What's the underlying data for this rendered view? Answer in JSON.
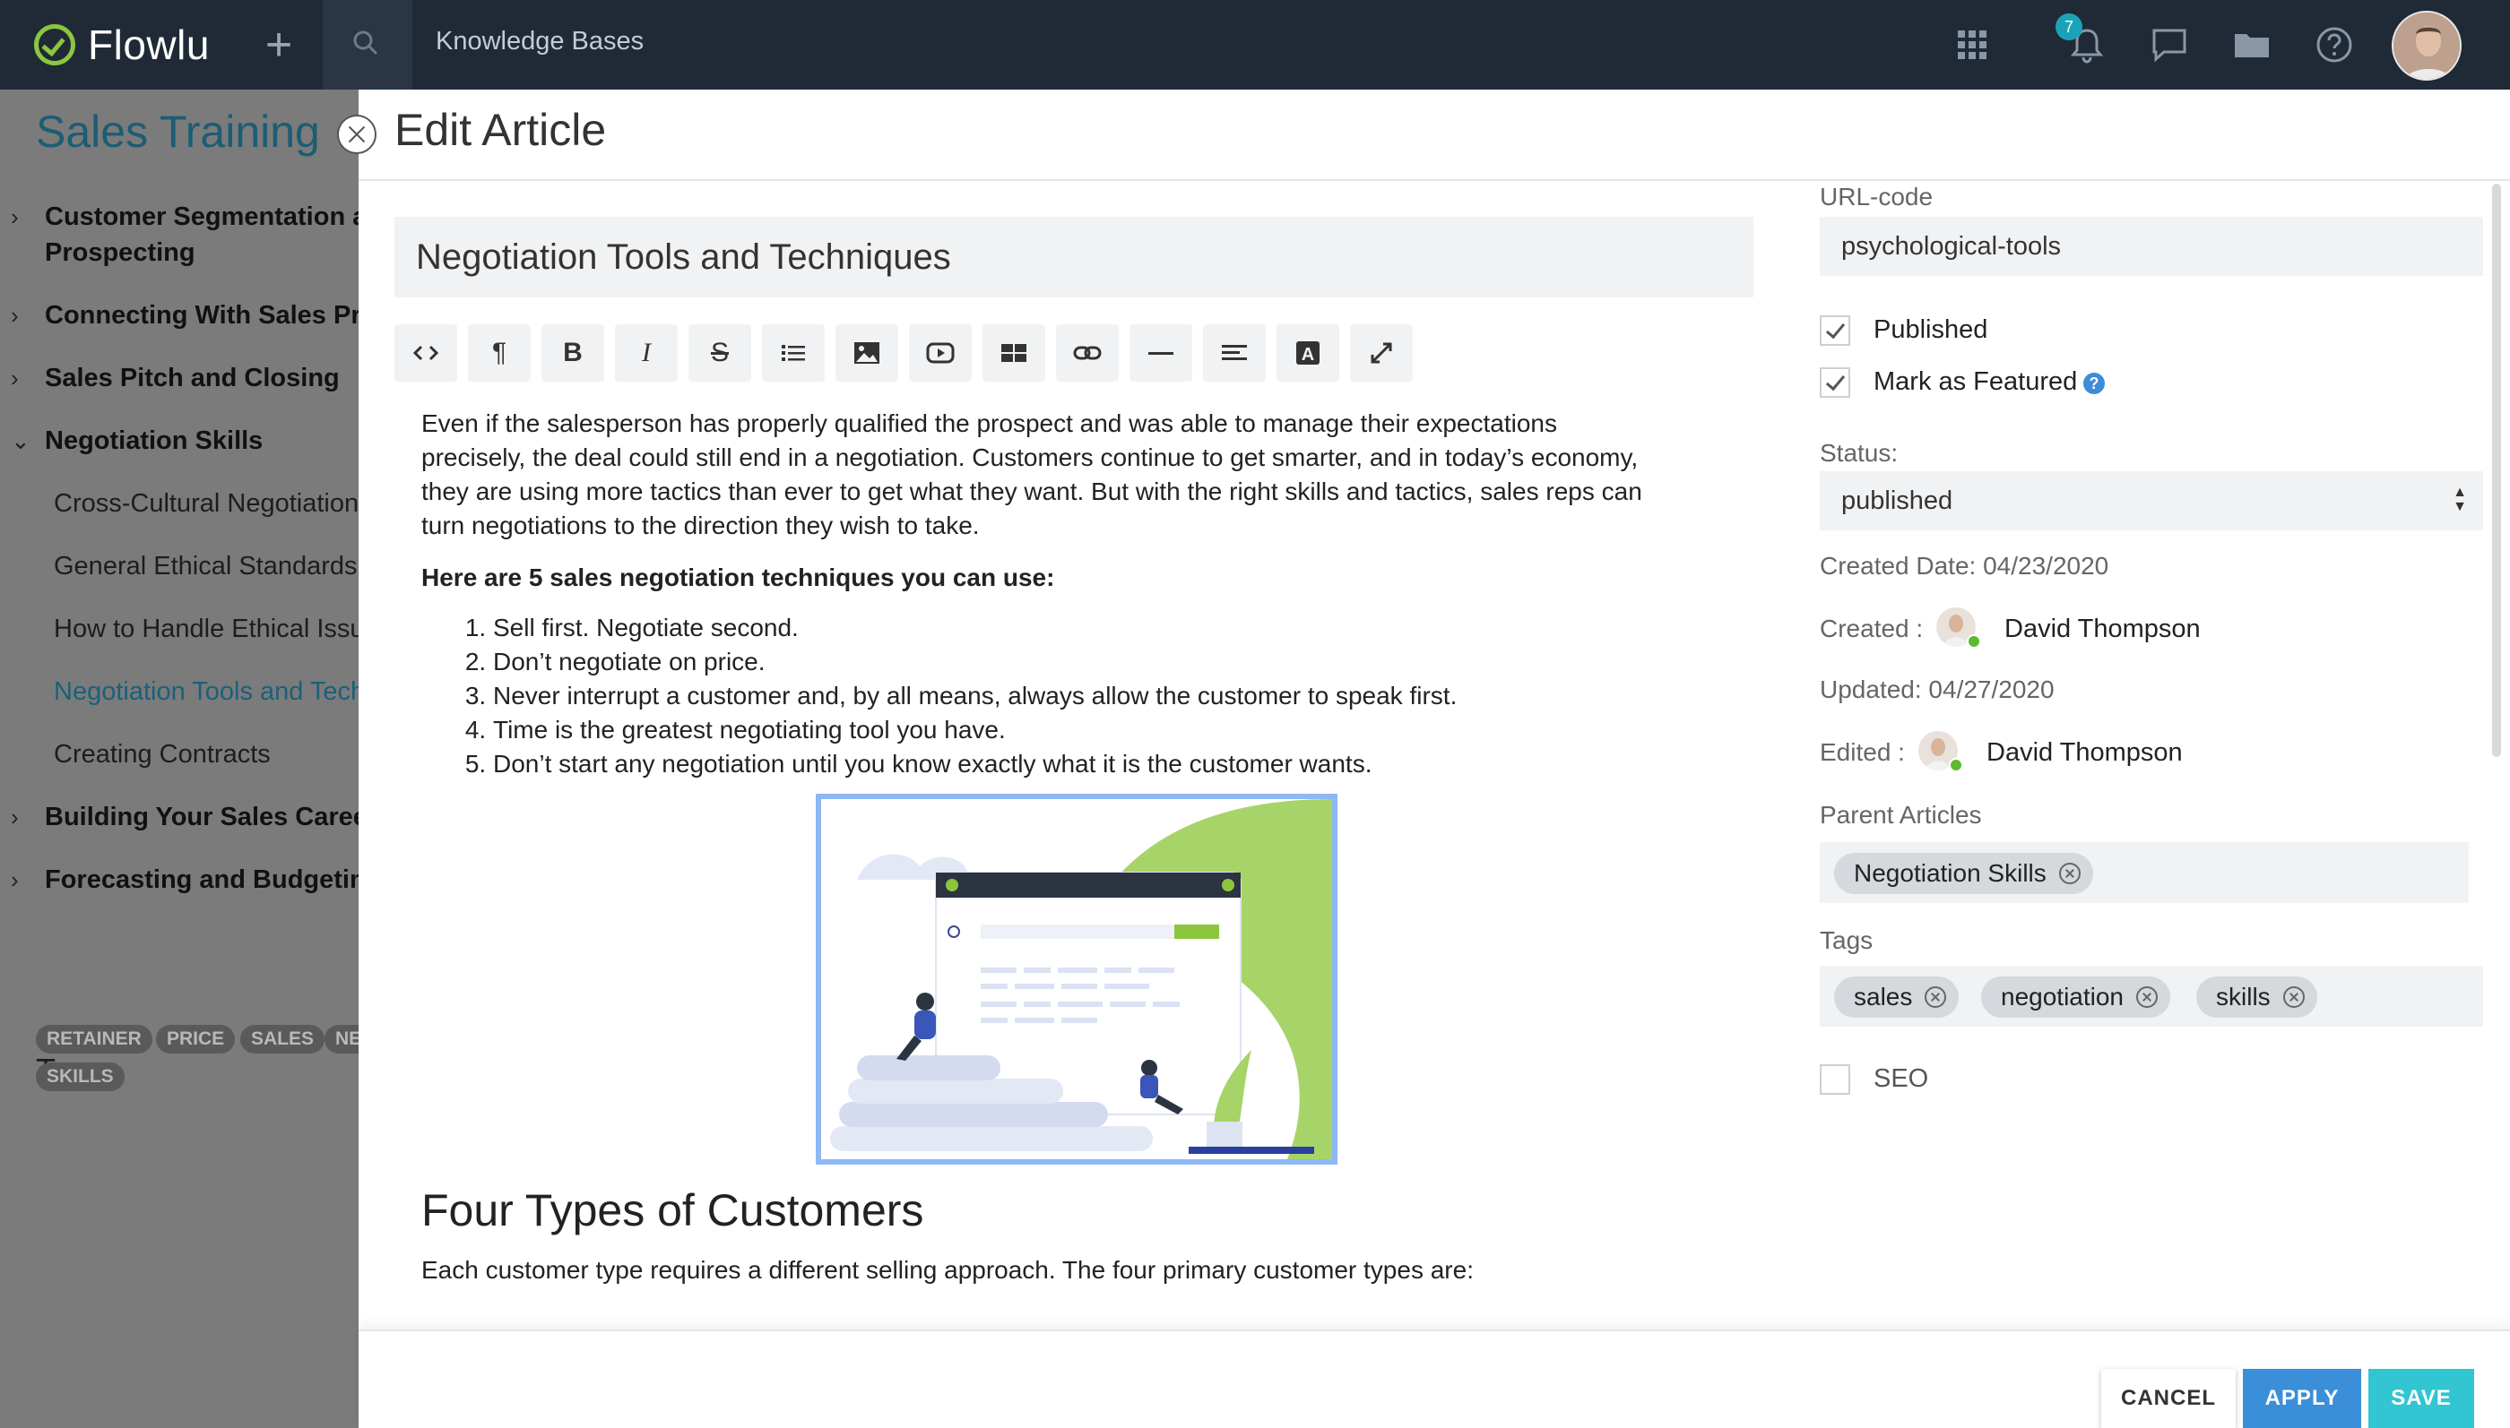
{
  "topbar": {
    "app_name": "Flowlu",
    "section": "Knowledge Bases",
    "notification_count": "7",
    "icons": [
      "plus-icon",
      "search-icon",
      "apps-grid-icon",
      "bell-icon",
      "chat-icon",
      "folder-icon",
      "help-icon",
      "avatar"
    ]
  },
  "sidebar": {
    "title": "Sales Training",
    "items": [
      {
        "label": "Customer Segmentation and",
        "level": 1,
        "expanded": false
      },
      {
        "label": "Prospecting",
        "level": 1
      },
      {
        "label": "Connecting With Sales Prospects",
        "level": 1,
        "expanded": false
      },
      {
        "label": "Sales Pitch and Closing",
        "level": 1,
        "expanded": false
      },
      {
        "label": "Negotiation Skills",
        "level": 1,
        "expanded": true
      },
      {
        "label": "Cross-Cultural Negotiation",
        "level": 2
      },
      {
        "label": "General Ethical Standards",
        "level": 2
      },
      {
        "label": "How to Handle Ethical Issues",
        "level": 2
      },
      {
        "label": "Negotiation Tools and Techniques",
        "level": 2,
        "active": true
      },
      {
        "label": "Creating Contracts",
        "level": 2
      },
      {
        "label": "Building Your Sales Career",
        "level": 1,
        "expanded": false
      },
      {
        "label": "Forecasting and Budgeting",
        "level": 1,
        "expanded": false
      }
    ],
    "tags_title": "Tags",
    "tags": [
      "RETAINER",
      "PRICE",
      "SALES",
      "NE",
      "SKILLS"
    ]
  },
  "modal": {
    "title": "Edit Article",
    "article_title": "Negotiation Tools and Techniques",
    "toolbar": [
      "html-icon",
      "paragraph-icon",
      "bold-icon",
      "italic-icon",
      "strikethrough-icon",
      "list-icon",
      "image-icon",
      "video-icon",
      "table-icon",
      "link-icon",
      "horizontal-rule-icon",
      "align-icon",
      "font-color-icon",
      "fullscreen-icon"
    ],
    "body": {
      "intro_lines": [
        "Even if the salesperson has properly qualified the prospect and was able to manage their expectations",
        "precisely, the deal could still end in a negotiation. Customers continue to get smarter, and in today’s economy,",
        "they are using more tactics than ever to get what they want. But with the right skills and tactics, sales reps can",
        "turn negotiations to the direction they wish to take."
      ],
      "bold_line": "Here are 5 sales negotiation techniques you can use:",
      "list": [
        "Sell first. Negotiate second.",
        "Don’t negotiate on price.",
        "Never interrupt a customer and, by all means, always allow the customer to speak first.",
        "Time is the greatest negotiating tool you have.",
        "Don’t start any negotiation until you know exactly what it is the customer wants."
      ],
      "heading2": "Four Types of Customers",
      "para2": "Each customer type requires a different selling approach. The four primary customer types are:"
    }
  },
  "panel": {
    "url_label": "URL-code",
    "url_value": "psychological-tools",
    "published_label": "Published",
    "published_checked": true,
    "featured_label": "Mark as Featured",
    "featured_checked": true,
    "status_label": "Status:",
    "status_value": "published",
    "created_date": "Created Date: 04/23/2020",
    "created_label": "Created :",
    "created_user": "David Thompson",
    "updated_date": "Updated: 04/27/2020",
    "edited_label": "Edited :",
    "edited_user": "David Thompson",
    "parent_label": "Parent Articles",
    "parent_chips": [
      "Negotiation Skills"
    ],
    "tags_label": "Tags",
    "tag_chips": [
      "sales",
      "negotiation",
      "skills"
    ],
    "seo_label": "SEO",
    "seo_checked": false
  },
  "footer": {
    "cancel": "CANCEL",
    "apply": "APPLY",
    "save": "SAVE"
  },
  "colors": {
    "topbar": "#1f2a36",
    "brand_green": "#8cc63f",
    "apply_blue": "#3a8fd8",
    "save_teal": "#32c5d2",
    "sidebar_title": "#1b5d74"
  }
}
